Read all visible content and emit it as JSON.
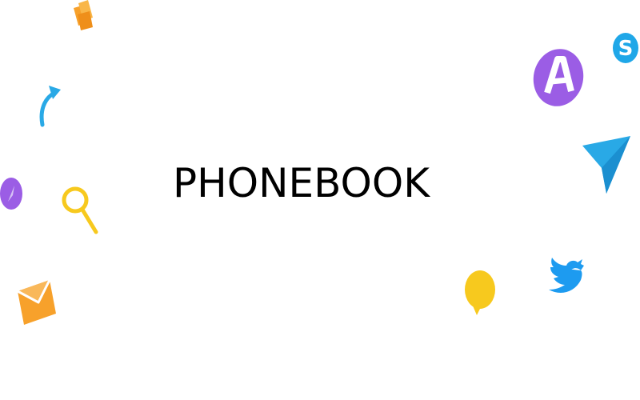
{
  "title": "PHONEBOOK",
  "icons": [
    "documents-icon",
    "share-arrow-icon",
    "compass-icon",
    "search-icon",
    "mail-icon",
    "letter-a-app-icon",
    "skype-icon",
    "send-icon",
    "twitter-icon",
    "chat-bubble-icon"
  ],
  "colors": {
    "background": "#ffffff",
    "text": "#000000",
    "orange": "#f7a12b",
    "blue": "#29a9e6",
    "purple": "#9b5de5",
    "yellow": "#f7c91e",
    "skype": "#1fa7e8",
    "twitter": "#1d9bf0"
  }
}
